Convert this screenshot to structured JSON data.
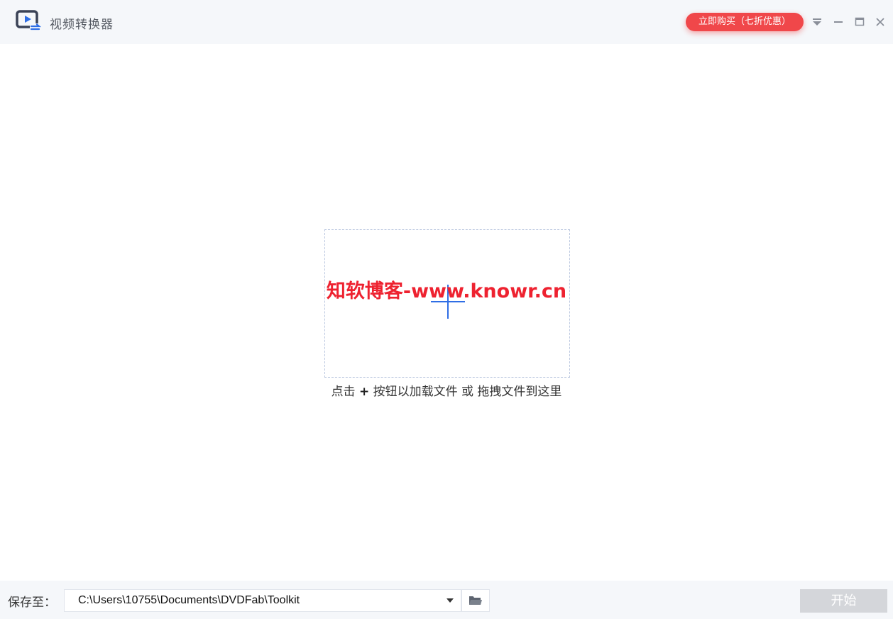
{
  "app": {
    "title": "视频转换器",
    "accent_color": "#2f6ee5"
  },
  "titlebar": {
    "buy_button_label": "立即购买（七折优惠）",
    "buy_button_color": "#f0474a",
    "icons": [
      "menu-dropdown-icon",
      "minimize-icon",
      "maximize-icon",
      "close-icon"
    ]
  },
  "main": {
    "watermark": "知软博客-www.knowr.cn",
    "drop_hint_prefix": "点击",
    "drop_hint_plus": "+",
    "drop_hint_suffix": "按钮以加载文件 或 拖拽文件到这里"
  },
  "footer": {
    "save_label": "保存至：",
    "path_value": "C:\\Users\\10755\\Documents\\DVDFab\\Toolkit",
    "start_label": "开始"
  }
}
